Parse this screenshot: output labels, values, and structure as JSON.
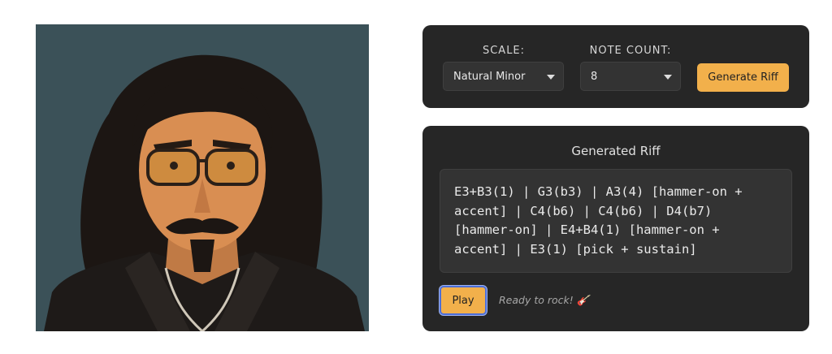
{
  "controls": {
    "scale_label": "SCALE:",
    "scale_value": "Natural Minor",
    "note_count_label": "NOTE COUNT:",
    "note_count_value": "8",
    "generate_label": "Generate Riff"
  },
  "output": {
    "title": "Generated Riff",
    "riff_text": "E3+B3(1) | G3(b3) | A3(4) [hammer-on + accent] | C4(b6) | C4(b6) | D4(b7) [hammer-on] | E4+B4(1) [hammer-on + accent] | E3(1) [pick + sustain]",
    "play_label": "Play",
    "status": "Ready to rock! 🎸"
  },
  "colors": {
    "accent": "#f2b04b",
    "panel": "#262626",
    "field": "#333333",
    "focus_ring": "#4d6fd9"
  },
  "icons": [
    "dropdown-caret-icon",
    "guitar-emoji"
  ]
}
